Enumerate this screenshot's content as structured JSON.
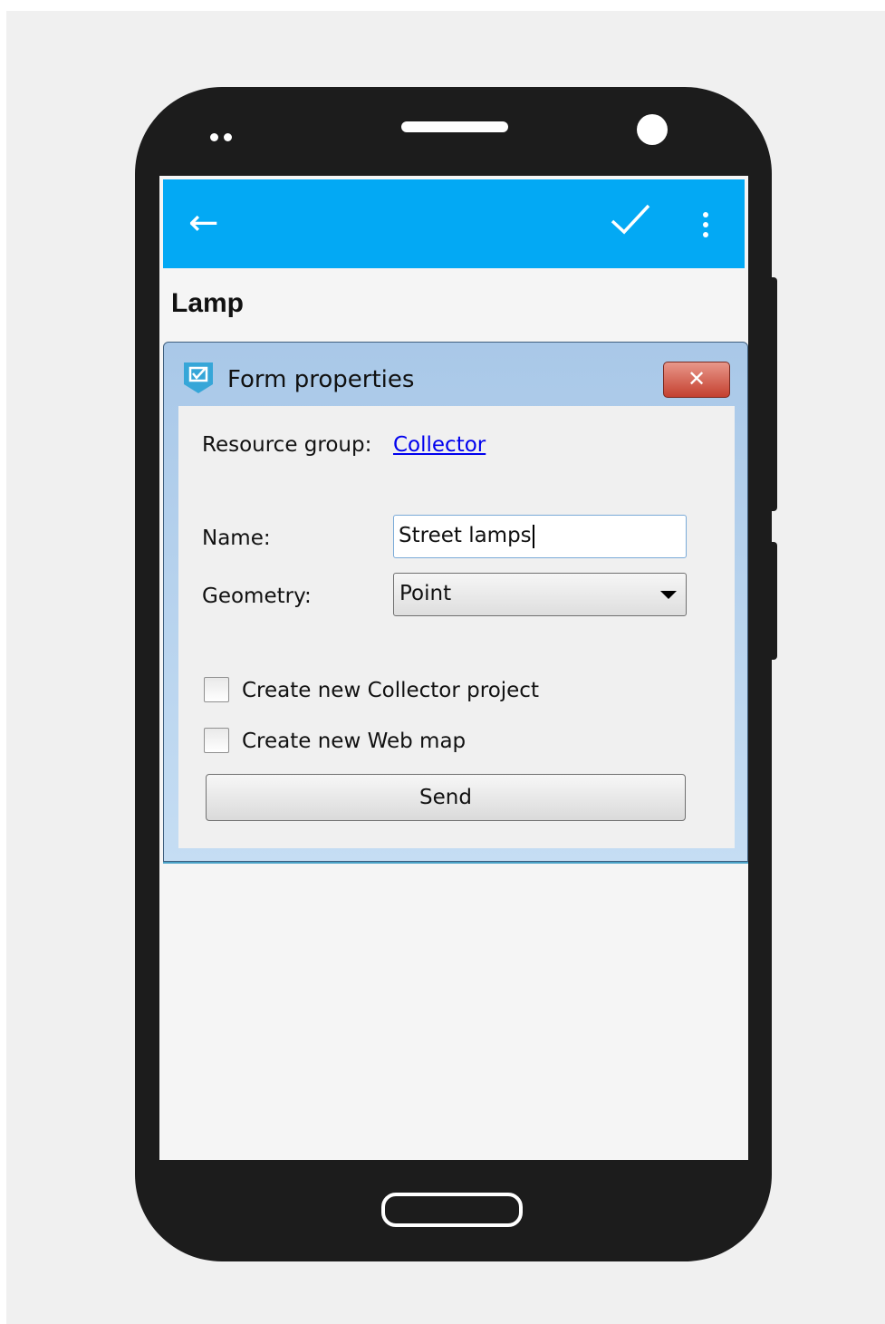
{
  "form_title": "Lamp",
  "colors": {
    "appbar": "#03a9f4",
    "phone_body": "#1c1c1c",
    "link": "#0000ee",
    "close_button": "#c4402f"
  },
  "appbar": {
    "back_icon": "arrow-left-icon",
    "confirm_icon": "checkmark-icon",
    "menu_icon": "more-vertical-icon"
  },
  "dialog": {
    "title": "Form properties",
    "close_label": "✕",
    "resource_group_label": "Resource group:",
    "resource_group_link": "Collector",
    "name_label": "Name:",
    "name_value": "Street lamps",
    "geometry_label": "Geometry:",
    "geometry_value": "Point",
    "checkbox_collector": "Create new Collector project",
    "checkbox_collector_checked": false,
    "checkbox_webmap": "Create new Web map",
    "checkbox_webmap_checked": false,
    "send_label": "Send"
  }
}
